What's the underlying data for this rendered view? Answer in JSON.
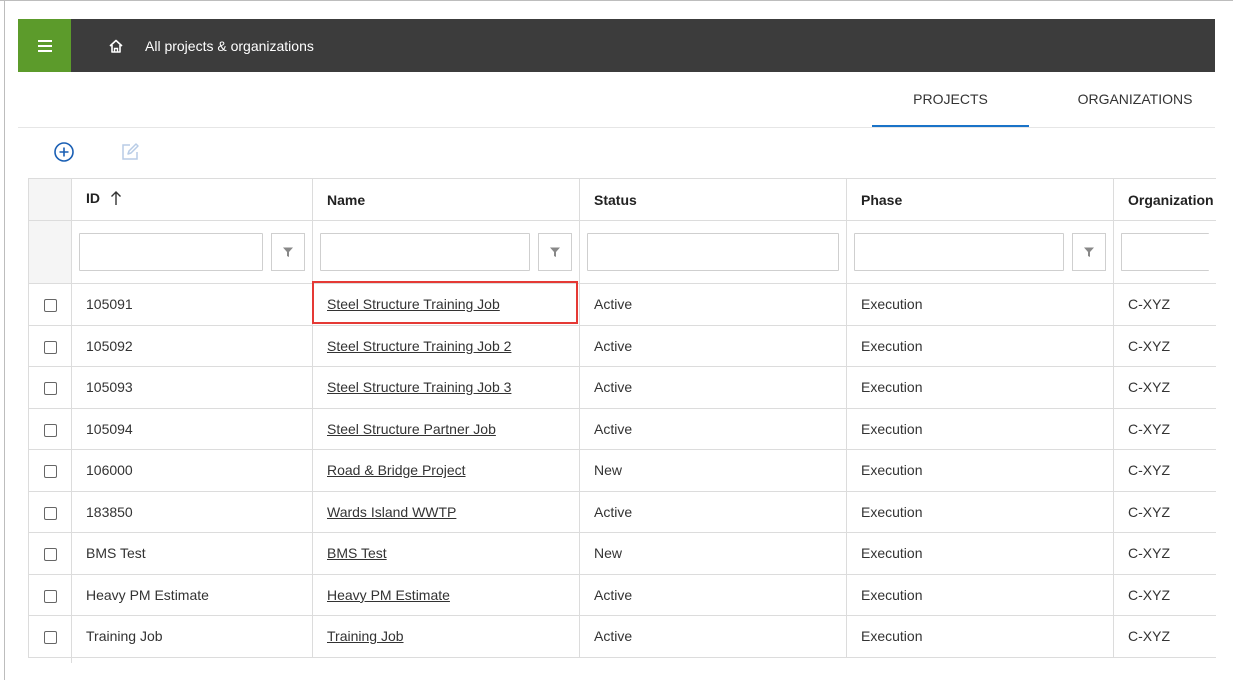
{
  "header": {
    "menu_icon": "hamburger-menu-icon",
    "home_icon": "home-icon",
    "title": "All projects & organizations",
    "accent_color": "#5c9b2b",
    "bar_color": "#3c3c3c"
  },
  "tabs": [
    {
      "label": "PROJECTS",
      "active": true
    },
    {
      "label": "ORGANIZATIONS",
      "active": false
    }
  ],
  "tab_indicator_color": "#1a73c8",
  "toolbar": {
    "add_icon": "add-circle-icon",
    "edit_icon": "edit-icon"
  },
  "table": {
    "columns": [
      {
        "label": "ID",
        "sorted": "ascending",
        "filter_button": true
      },
      {
        "label": "Name",
        "filter_button": true
      },
      {
        "label": "Status",
        "filter_button": false
      },
      {
        "label": "Phase",
        "filter_button": true
      },
      {
        "label": "Organization",
        "filter_button": false
      }
    ],
    "rows": [
      {
        "id": "105091",
        "name": "Steel Structure Training Job",
        "status": "Active",
        "phase": "Execution",
        "organization": "C-XYZ",
        "highlighted": true
      },
      {
        "id": "105092",
        "name": "Steel Structure Training Job 2",
        "status": "Active",
        "phase": "Execution",
        "organization": "C-XYZ"
      },
      {
        "id": "105093",
        "name": "Steel Structure Training Job 3",
        "status": "Active",
        "phase": "Execution",
        "organization": "C-XYZ"
      },
      {
        "id": "105094",
        "name": "Steel Structure Partner Job",
        "status": "Active",
        "phase": "Execution",
        "organization": "C-XYZ"
      },
      {
        "id": "106000",
        "name": "Road & Bridge Project",
        "status": "New",
        "phase": "Execution",
        "organization": "C-XYZ"
      },
      {
        "id": "183850",
        "name": "Wards Island WWTP",
        "status": "Active",
        "phase": "Execution",
        "organization": "C-XYZ"
      },
      {
        "id": "BMS Test",
        "name": "BMS Test",
        "status": "New",
        "phase": "Execution",
        "organization": "C-XYZ"
      },
      {
        "id": "Heavy PM Estimate",
        "name": "Heavy PM Estimate",
        "status": "Active",
        "phase": "Execution",
        "organization": "C-XYZ"
      },
      {
        "id": "Training Job",
        "name": "Training Job",
        "status": "Active",
        "phase": "Execution",
        "organization": "C-XYZ"
      }
    ],
    "highlight_color": "#e53935"
  }
}
